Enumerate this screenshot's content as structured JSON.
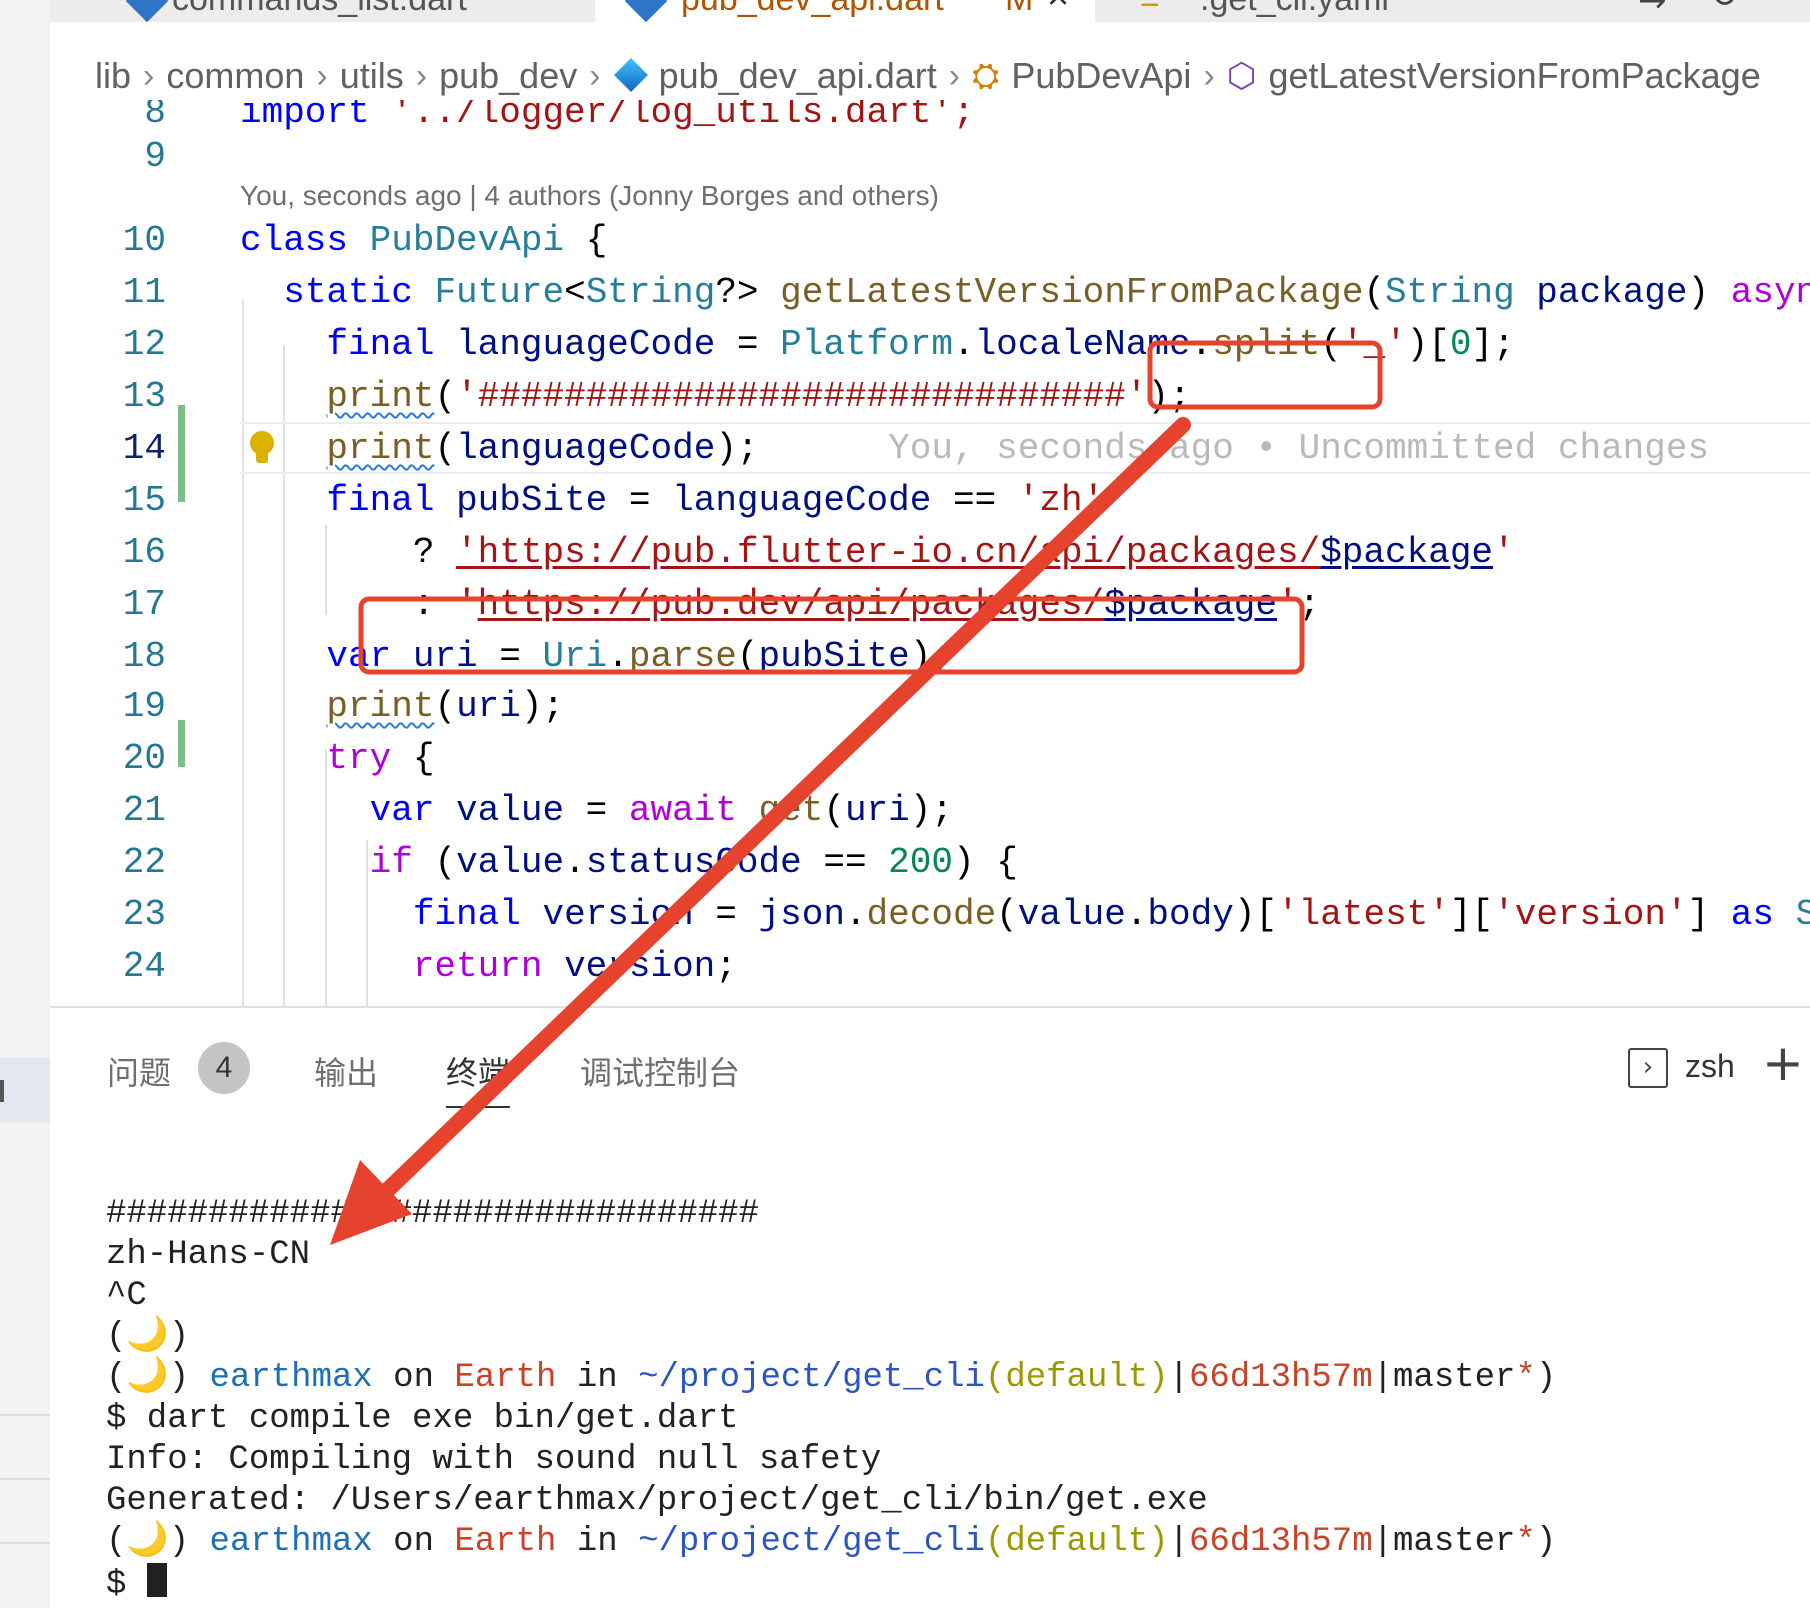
{
  "tabs": [
    {
      "label": "commands_list.dart"
    },
    {
      "label": "pub_dev_api.dart",
      "modified": "M"
    },
    {
      "label": ".get_cli.yaml"
    }
  ],
  "breadcrumb": [
    "lib",
    "common",
    "utils",
    "pub_dev",
    "pub_dev_api.dart",
    "PubDevApi",
    "getLatestVersionFromPackage"
  ],
  "editor": {
    "blame": "You, seconds ago | 4 authors (Jonny Borges and others)",
    "inline_blame": "You, seconds ago • Uncommitted changes",
    "line_numbers": [
      "8",
      "9",
      "10",
      "11",
      "12",
      "13",
      "14",
      "15",
      "16",
      "17",
      "18",
      "19",
      "20",
      "21",
      "22",
      "23",
      "24"
    ]
  },
  "code": {
    "l8": [
      "import",
      " '../logger/log_utils.dart';"
    ],
    "l10": [
      "class",
      "PubDevApi",
      "{"
    ],
    "l11": [
      "static",
      "Future",
      "<",
      "String",
      "?>",
      "getLatestVersionFromPackage",
      "(",
      "String",
      "package",
      ")",
      "async",
      "{"
    ],
    "l12": [
      "final",
      "languageCode",
      " = ",
      "Platform",
      ".",
      "localeName",
      ".",
      "split",
      "(",
      "'_'",
      ")",
      "[",
      "0",
      "];"
    ],
    "l13": [
      "print",
      "(",
      "'##############################'",
      ");"
    ],
    "l14": [
      "print",
      "(",
      "languageCode",
      ");"
    ],
    "l15": [
      "final",
      "pubSite",
      " = ",
      "languageCode",
      " == ",
      "'zh'"
    ],
    "l16": [
      "? ",
      "'",
      "https://pub.flutter-io.cn/api/packages/",
      "$package",
      "'"
    ],
    "l17": [
      ": ",
      "'",
      "https://pub.dev/api/packages/",
      "$package",
      "'",
      ";"
    ],
    "l18": [
      "var",
      "uri",
      " = ",
      "Uri",
      ".",
      "parse",
      "(",
      "pubSite",
      ");"
    ],
    "l19": [
      "print",
      "(",
      "uri",
      ");"
    ],
    "l20": [
      "try",
      "{"
    ],
    "l21": [
      "var",
      "value",
      " = ",
      "await",
      "get",
      "(",
      "uri",
      ");"
    ],
    "l22": [
      "if",
      "(",
      "value",
      ".",
      "statusCode",
      " == ",
      "200",
      ") {"
    ],
    "l23": [
      "final",
      "version",
      " = ",
      "json",
      ".",
      "decode",
      "(",
      "value",
      ".",
      "body",
      ")[",
      "'latest'",
      "][",
      "'version'",
      "] ",
      "as",
      "Stri"
    ],
    "l24": [
      "return",
      "version",
      ";"
    ]
  },
  "panel": {
    "tabs": [
      "问题",
      "输出",
      "终端",
      "调试控制台"
    ],
    "problems_count": "4",
    "active_tab": "终端",
    "shell": "zsh",
    "add_icon": "plus-icon"
  },
  "terminal": {
    "hashes": "################################",
    "locale_output": "zh-Hans-CN",
    "ctrl_c": "^C",
    "moon": "(🌙)",
    "prompt": {
      "open": "(🌙) ",
      "user": "earthmax",
      "on": " on ",
      "host": "Earth",
      "in": " in ",
      "path": "~/project/get_cli",
      "env_open": "(",
      "env": "(default)",
      "pipe1": "|",
      "time": "66d13h57m",
      "pipe2": "|",
      "branch": "master",
      "star": "*",
      "close": ")"
    },
    "command": "$ dart compile exe bin/get.dart",
    "info": "Info: Compiling with sound null safety",
    "generated": "Generated: /Users/earthmax/project/get_cli/bin/get.exe",
    "last_prompt": "$ "
  },
  "colors": {
    "keyword": "#0000ff",
    "type": "#267f99",
    "function": "#795e26",
    "variable": "#001080",
    "string": "#a31515",
    "control": "#af00db",
    "annotation": "#e5432d",
    "git_added": "#7dbf88"
  }
}
